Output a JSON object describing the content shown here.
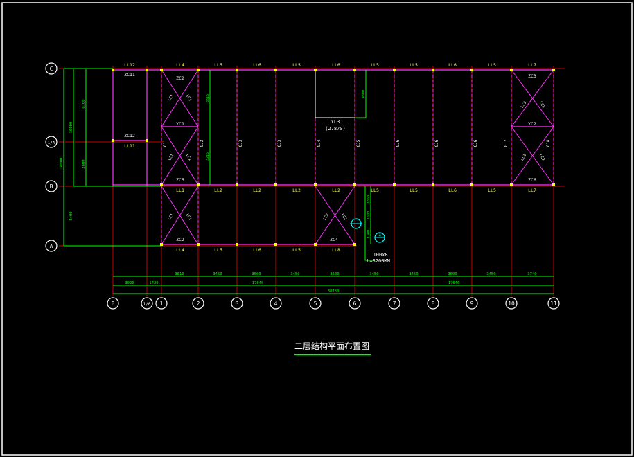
{
  "drawing": {
    "title": "二层结构平面布置图",
    "colors": {
      "background": "#000000",
      "axis_line": "#c80000",
      "dimension": "#00ff00",
      "member": "#ff33ff",
      "label": "#ffffff",
      "node": "#ffff00",
      "callout": "#00ffff"
    },
    "axis_bubbles": {
      "bottom": [
        "0",
        "1/0",
        "1",
        "2",
        "3",
        "4",
        "5",
        "6",
        "7",
        "8",
        "9",
        "10",
        "11"
      ],
      "left": [
        "C",
        "1/A",
        "B",
        "A"
      ]
    },
    "beam_labels": {
      "top_row": [
        "LL12",
        "LL4",
        "LL5",
        "LL6",
        "LL5",
        "LL6",
        "LL5",
        "LL5",
        "LL6",
        "LL5",
        "LL7"
      ],
      "row_b": [
        "LL1",
        "LL2",
        "LL2",
        "LL2",
        "LL2",
        "LL5",
        "LL5",
        "LL6",
        "LL5",
        "LL7"
      ],
      "row_a": [
        "LL4",
        "LL5",
        "LL6",
        "LL5",
        "LL8"
      ],
      "mid_left": "LL11"
    },
    "column_labels": [
      "GJ1",
      "GJ2",
      "GJ3",
      "GJ3",
      "GJ4",
      "GJ5",
      "GJ6",
      "GJ6",
      "GJ6",
      "GJ7",
      "GJ8"
    ],
    "bracing": {
      "zc_labels": [
        "ZC11",
        "ZC12",
        "ZC2",
        "ZC5",
        "ZC2",
        "ZC4",
        "ZC3",
        "ZC6"
      ],
      "lc_labels": [
        "LC1",
        "LC1",
        "LC1",
        "LC1",
        "LC1",
        "LC1",
        "LC2",
        "LC2",
        "LC3",
        "LC3",
        "LC3",
        "LC3"
      ],
      "yc_labels": [
        "YC1",
        "YC2"
      ]
    },
    "annotations": {
      "opening_label": "YL3",
      "opening_level": "(2.870)",
      "angle_size": "L100x8",
      "angle_length": "L=3200MM",
      "callout_mark": "1"
    },
    "dimensions": {
      "bay_row": [
        "3810",
        "3450",
        "3600",
        "3450",
        "3600",
        "3450",
        "3450",
        "3600",
        "3450",
        "3740"
      ],
      "group_row": [
        "3020",
        "1720",
        "17640",
        "17640"
      ],
      "overall": "38780",
      "left_dims": [
        "6100",
        "3800",
        "10000",
        "14000",
        "5400"
      ],
      "internal_dims": [
        "3315",
        "3215",
        "4800",
        "1850",
        "1600",
        "1300"
      ]
    }
  }
}
